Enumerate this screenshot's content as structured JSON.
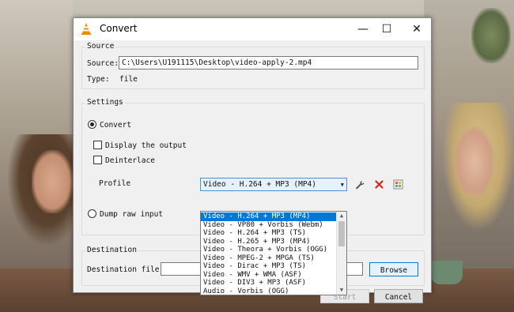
{
  "window": {
    "title": "Convert",
    "minimize_glyph": "—",
    "maximize_glyph": "☐",
    "close_glyph": "✕"
  },
  "source": {
    "group_label": "Source",
    "source_label": "Source:",
    "source_value": "C:\\Users\\U191115\\Desktop\\video-apply-2.mp4",
    "type_label": "Type:",
    "type_value": "file"
  },
  "settings": {
    "group_label": "Settings",
    "convert_label": "Convert",
    "convert_checked": true,
    "display_output_label": "Display the output",
    "deinterlace_label": "Deinterlace",
    "profile_label": "Profile",
    "profile_selected": "Video - H.264 + MP3 (MP4)",
    "dump_raw_label": "Dump raw input",
    "profile_options": [
      "Video - H.264 + MP3 (MP4)",
      "Video - VP80 + Vorbis (Webm)",
      "Video - H.264 + MP3 (TS)",
      "Video - H.265 + MP3 (MP4)",
      "Video - Theora + Vorbis (OGG)",
      "Video - MPEG-2 + MPGA (TS)",
      "Video - Dirac + MP3 (TS)",
      "Video - WMV + WMA (ASF)",
      "Video - DIV3 + MP3 (ASF)",
      "Audio - Vorbis (OGG)"
    ],
    "tool_icons": [
      "wrench-icon",
      "delete-icon",
      "new-profile-icon"
    ],
    "colors": {
      "delete": "#d9261c",
      "selection": "#0078d7"
    }
  },
  "destination": {
    "group_label": "Destination",
    "file_label": "Destination file:",
    "file_value": "",
    "browse_label": "Browse"
  },
  "buttons": {
    "start_label": "Start",
    "cancel_label": "Cancel"
  }
}
